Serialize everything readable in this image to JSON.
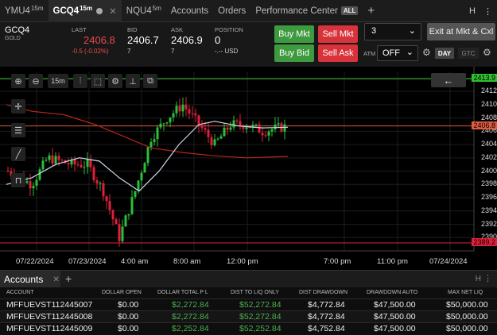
{
  "tabs": [
    {
      "label": "YMU4",
      "sup": "15m"
    },
    {
      "label": "GCQ4",
      "sup": "15m",
      "active": true
    },
    {
      "label": "NQU4",
      "sup": "5m"
    },
    {
      "label": "Accounts"
    },
    {
      "label": "Orders"
    },
    {
      "label": "Performance Center",
      "badge": "ALL"
    }
  ],
  "topbar_right": {
    "h_label": "H"
  },
  "quote": {
    "symbol": "GCQ4",
    "symbol_sub": "GOLD",
    "last_label": "LAST",
    "last": "2406.8",
    "change": "-0.5 (-0.02%)",
    "bid_label": "BID",
    "bid": "2406.7",
    "bid_size": "7",
    "ask_label": "ASK",
    "ask": "2406.9",
    "ask_size": "7",
    "position_label": "POSITION",
    "position": "0",
    "position_sub": "-.-- USD"
  },
  "order": {
    "buy_mkt": "Buy Mkt",
    "sell_mkt": "Sell Mkt",
    "buy_bid": "Buy Bid",
    "sell_ask": "Sell Ask",
    "quantity": "3",
    "exit": "Exit at Mkt & Cxl",
    "atm_label": "ATM",
    "atm_value": "OFF",
    "tif_day": "DAY",
    "tif_gtc": "GTC"
  },
  "chart_toolbar": {
    "interval": "15m"
  },
  "chart_data": {
    "type": "candlestick",
    "y_ticks": [
      2414,
      2412,
      2410,
      2408,
      2406,
      2404,
      2402,
      2400,
      2398,
      2396,
      2394,
      2392,
      2390
    ],
    "price_tags": [
      "2413.9",
      "2406.8",
      "2389.2"
    ],
    "x_ticks": [
      "07/22/2024",
      "07/23/2024",
      "4:00 am",
      "8:00 am",
      "12:00 pm",
      "7:00 pm",
      "11:00 pm",
      "07/24/2024"
    ],
    "ylim": [
      2388,
      2415
    ],
    "colors": {
      "up": "#2bbf3a",
      "down": "#e0203a",
      "ma_fast": "#c9d8e8",
      "ma_slow": "#b3261e",
      "line_high": "#2fbf2f",
      "line_last": "#e05a40",
      "line_low": "#e0203a"
    }
  },
  "accounts": {
    "tab_label": "Accounts",
    "columns": [
      "ACCOUNT",
      "DOLLAR OPEN",
      "DOLLAR TOTAL P L",
      "DIST TO LIQ ONLY",
      "DIST DRAWDOWN",
      "DRAWDOWN AUTO",
      "MAX NET LIQ"
    ],
    "rows": [
      [
        "MFFUEVST112445007",
        "$0.00",
        "$2,272.84",
        "$52,272.84",
        "$4,772.84",
        "$47,500.00",
        "$50,000.00"
      ],
      [
        "MFFUEVST112445008",
        "$0.00",
        "$2,272.84",
        "$52,272.84",
        "$4,772.84",
        "$47,500.00",
        "$50,000.00"
      ],
      [
        "MFFUEVST112445009",
        "$0.00",
        "$2,252.84",
        "$52,252.84",
        "$4,752.84",
        "$47,500.00",
        "$50,000.00"
      ]
    ]
  }
}
